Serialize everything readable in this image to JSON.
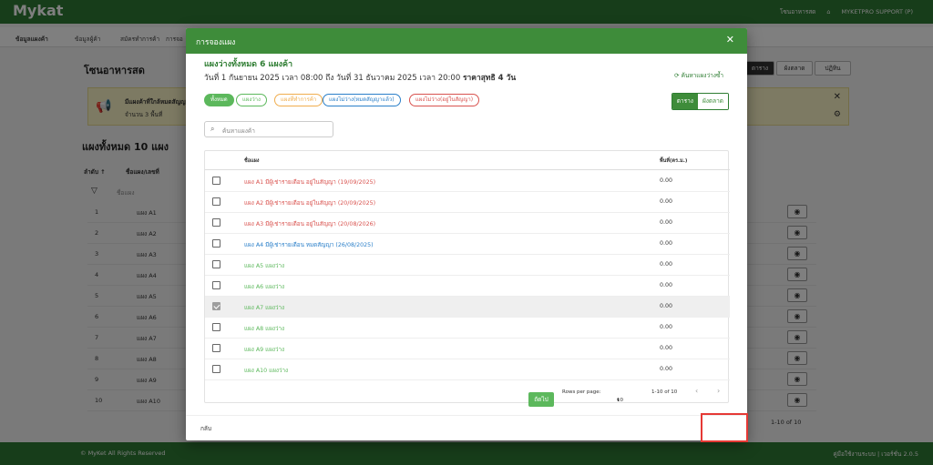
{
  "app": {
    "brand": "Mykat",
    "topbar_right": [
      "โซนอาหารสด",
      "MYKETPRO SUPPORT (P)"
    ],
    "nav_tabs": [
      "ข้อมูลแผงค้า",
      "ข้อมูลผู้ค้า",
      "สมัครทำการค้า",
      "การจอ"
    ]
  },
  "background": {
    "zone_title": "โซนอาหารสด",
    "right_buttons": [
      "ตาราง",
      "ผังตลาด",
      "ปฏิทิน"
    ],
    "alert_title": "มีแผงค้าที่ใกล้หมดสัญญา",
    "alert_count": "จำนวน 3 พื้นที่",
    "list_title": "แผงทั้งหมด 10 แผง",
    "col_order": "ลำดับ ↑",
    "col_name": "ชื่อแผง/เลขที่",
    "filter_placeholder": "ชื่อแผง",
    "rows": [
      {
        "no": "1",
        "name": "แผง A1"
      },
      {
        "no": "2",
        "name": "แผง A2"
      },
      {
        "no": "3",
        "name": "แผง A3"
      },
      {
        "no": "4",
        "name": "แผง A4"
      },
      {
        "no": "5",
        "name": "แผง A5"
      },
      {
        "no": "6",
        "name": "แผง A6"
      },
      {
        "no": "7",
        "name": "แผง A7"
      },
      {
        "no": "8",
        "name": "แผง A8"
      },
      {
        "no": "9",
        "name": "แผง A9"
      },
      {
        "no": "10",
        "name": "แผง A10"
      }
    ],
    "pager_text": "1-10 of 10",
    "footer_left": "© MyKet All Rights Reserved",
    "footer_right": "คู่มือใช้งานระบบ | เวอร์ชั่น 2.0.5"
  },
  "modal": {
    "title": "การจองแผง",
    "close_glyph": "✕",
    "headline": "แผงว่างทั้งหมด 6 แผงค้า",
    "date_range": "วันที่ 1 กันยายน 2025 เวลา 08:00 ถึง วันที่ 31 ธันวาคม 2025 เวลา 20:00",
    "price_label": "ราคาสุทธิ 4 วัน",
    "search_empty": "ค้นหาแผงว่างซ้ำ",
    "filters": [
      {
        "label": "ทั้งหมด"
      },
      {
        "label": "แผงว่าง"
      },
      {
        "label": "แผงที่ทำการค้า"
      },
      {
        "label": "แผงไม่ว่าง(หมดสัญญาแล้ว)"
      },
      {
        "label": "แผงไม่ว่าง(อยู่ในสัญญา)"
      }
    ],
    "view_table": "ตาราง",
    "view_map": "ผังตลาด",
    "search_placeholder": "ค้นหาแผงค้า",
    "col_name": "ชื่อแผง",
    "col_area": "พื้นที่(ตร.ม.)",
    "rows": [
      {
        "name": "แผง A1 มีผู้เช่ารายเดือน อยู่ในสัญญา (19/09/2025)",
        "area": "0.00",
        "status": "occupied",
        "checked": false
      },
      {
        "name": "แผง A2 มีผู้เช่ารายเดือน อยู่ในสัญญา (20/09/2025)",
        "area": "0.00",
        "status": "occupied",
        "checked": false
      },
      {
        "name": "แผง A3 มีผู้เช่ารายเดือน อยู่ในสัญญา (20/08/2026)",
        "area": "0.00",
        "status": "occupied",
        "checked": false
      },
      {
        "name": "แผง A4 มีผู้เช่ารายเดือน หมดสัญญา (26/08/2025)",
        "area": "0.00",
        "status": "expired",
        "checked": false
      },
      {
        "name": "แผง A5 แผงว่าง",
        "area": "0.00",
        "status": "free",
        "checked": false
      },
      {
        "name": "แผง A6 แผงว่าง",
        "area": "0.00",
        "status": "free",
        "checked": false
      },
      {
        "name": "แผง A7 แผงว่าง",
        "area": "0.00",
        "status": "free",
        "checked": true
      },
      {
        "name": "แผง A8 แผงว่าง",
        "area": "0.00",
        "status": "free",
        "checked": false
      },
      {
        "name": "แผง A9 แผงว่าง",
        "area": "0.00",
        "status": "free",
        "checked": false
      },
      {
        "name": "แผง A10 แผงว่าง",
        "area": "0.00",
        "status": "free",
        "checked": false
      }
    ],
    "rows_per_page_label": "Rows per page:",
    "rows_per_page_value": "10",
    "page_range": "1-10 of 10",
    "back_label": "กลับ",
    "next_label": "ถัดไป"
  },
  "colors": {
    "brand_green": "#2f7a35",
    "occupied": "#d9534f",
    "expired": "#2a7fc9",
    "free": "#5cb85c",
    "highlight": "#e53935"
  }
}
